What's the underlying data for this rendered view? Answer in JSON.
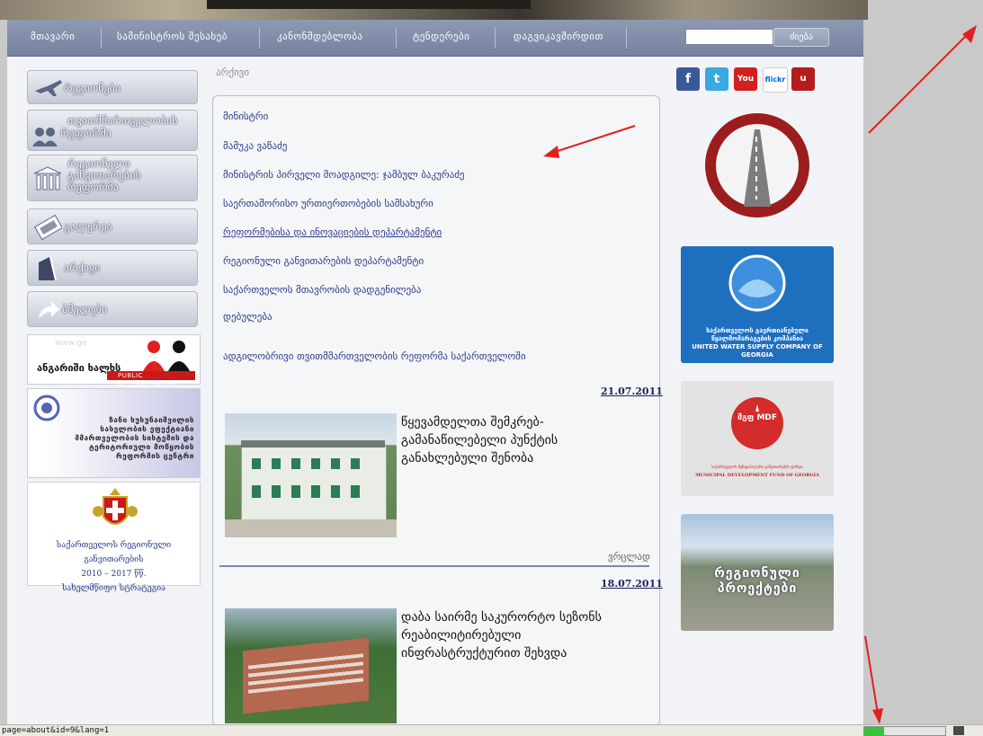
{
  "nav": {
    "items": [
      "მთავარი",
      "სამინისტროს შესახებ",
      "კანონმდებლობა",
      "ტენდერები",
      "დაგვიკავშირდით"
    ],
    "search_button": "ძიება",
    "search_value": ""
  },
  "sidebar": {
    "items": [
      {
        "label": "რეგიონები",
        "icon": "plane-icon"
      },
      {
        "label1": "თვითმმართველობის",
        "label2": "რეფორმა",
        "icon": "people-icon"
      },
      {
        "label1": "რეგიონული",
        "label2": "განვითარების",
        "label3": "რეფორმა",
        "icon": "columns-icon"
      },
      {
        "label": "გალერეა",
        "icon": "film-icon"
      },
      {
        "label": "არქივი",
        "icon": "archive-icon"
      },
      {
        "label": "ბმულები",
        "icon": "arrow-icon"
      }
    ],
    "banner1": {
      "main": "ანგარიში ხალხს",
      "sub": "PUBLIC ACCOUNTABILITY",
      "watermark": "www.ge"
    },
    "banner2": {
      "lines": [
        "ზანი ხუხუნაიშვილის",
        "სახელობის ეფექტიანი",
        "მმართველობის სისტემის და",
        "ტერიტორიული მოწყობის",
        "რეფორმის ცენტრი"
      ]
    },
    "banner3": {
      "line1": "საქართველოს რეგიონული განვითარების",
      "line2": "2010 – 2017 წწ.",
      "line3": "სახელმწიფო სტრატეგია"
    }
  },
  "breadcrumb": "არქივი",
  "content": {
    "links": [
      "მინისტრი",
      "მამუკა ვაწაძე",
      "მინისტრის პირველი მოადგილე: ჯამბულ ბაკურაძე",
      "საერთაშორისო ურთიერთობების სამსახური",
      "რეფორმებისა და ინოვაციების დეპარტამენტი",
      "რეგიონული განვითარების დეპარტამენტი",
      "საქართველოს მთავრობის დადგენილება",
      "დებულება",
      "ადგილობრივი თვითმმართველობის რეფორმა საქართველოში"
    ],
    "news": [
      {
        "date": "21.07.2011",
        "title": "წყევამდელთა შემკრებ-გამანაწილებელი პუნქტის განახლებული შენობა"
      },
      {
        "date": "18.07.2011",
        "title": "დაბა საირმე საკურორტო სეზონს რეაბილიტირებული ინფრასტრუქტურით შეხვდა"
      }
    ],
    "more_label": "ვრცლად"
  },
  "social": [
    {
      "name": "facebook-icon",
      "glyph": "f",
      "color": "#3b5998"
    },
    {
      "name": "twitter-icon",
      "glyph": "t",
      "color": "#39a9e0"
    },
    {
      "name": "youtube-icon",
      "glyph": "You",
      "color": "#d21f1f"
    },
    {
      "name": "flickr-icon",
      "glyph": "flickr",
      "color": "#ffffff"
    },
    {
      "name": "ustream-icon",
      "glyph": "u",
      "color": "#b51c1c"
    }
  ],
  "right_banners": {
    "roads": "Georgian Roads Department",
    "water": {
      "line1": "საქართველოს გაერთიანებული",
      "line2": "წყალმომარაგების კომპანია",
      "line3": "UNITED WATER SUPPLY COMPANY OF GEORGIA"
    },
    "mdf": {
      "logo": "მგფ MDF",
      "line1": "საქართველოს მუნიციპალური განვითარების ფონდი",
      "line2": "MUNICIPAL DEVELOPMENT FUND OF GEORGIA"
    },
    "projects": {
      "line1": "რეგიონული",
      "line2": "პროექტები"
    }
  },
  "status": {
    "url": "page=about&id=9&lang=1",
    "progress": 0.24
  },
  "colors": {
    "nav": "#8f99b3",
    "link": "#2b3a8a",
    "arrow": "#e0201d"
  }
}
